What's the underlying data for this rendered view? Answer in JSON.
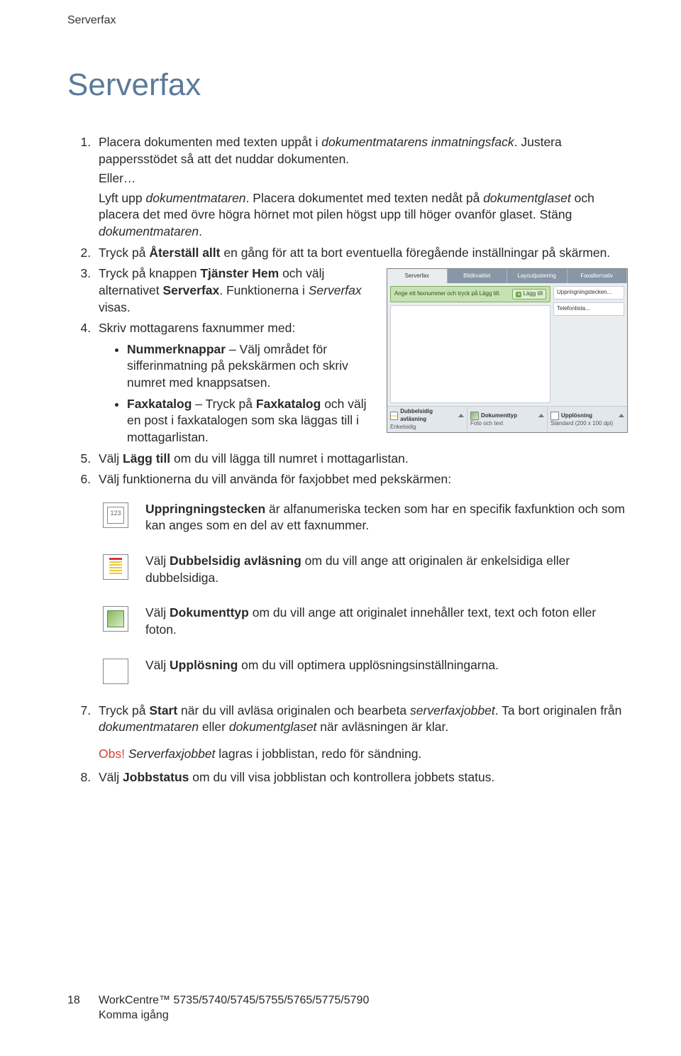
{
  "running_head": "Serverfax",
  "title": "Serverfax",
  "steps": {
    "s1a": "Placera dokumenten med texten uppåt i ",
    "s1a_i": "dokumentmatarens inmatningsfack",
    "s1a_end": ". Justera pappersstödet så att det nuddar dokumenten.",
    "s1_or": "Eller…",
    "s1b": "Lyft upp ",
    "s1b_i": "dokumentmataren",
    "s1b_end": ". Placera dokumentet med texten nedåt på ",
    "s1b_i2": "dokumentglaset",
    "s1b_end2": " och placera det med övre högra hörnet mot pilen högst upp till höger ovanför glaset. Stäng ",
    "s1b_i3": "dokumentmataren",
    "s1b_end3": ".",
    "s2a": "Tryck på ",
    "s2b": "Återställ allt",
    "s2c": " en gång för att ta bort eventuella föregående inställningar på skärmen.",
    "s3a": "Tryck på knappen ",
    "s3b": "Tjänster Hem",
    "s3c": " och välj alternativet ",
    "s3d": "Serverfax",
    "s3e": ". Funktionerna i ",
    "s3f": "Serverfax",
    "s3g": " visas.",
    "s4": "Skriv mottagarens faxnummer med:",
    "s4_b1a": "Nummerknappar",
    "s4_b1b": " – Välj området för sifferinmatning på pekskärmen och skriv numret med knappsatsen.",
    "s4_b2a": "Faxkatalog",
    "s4_b2b": " – Tryck på ",
    "s4_b2c": "Faxkatalog",
    "s4_b2d": " och välj en post i faxkatalogen som ska läggas till i mottagarlistan.",
    "s5a": "Välj ",
    "s5b": "Lägg till",
    "s5c": " om du vill lägga till numret i mottagarlistan.",
    "s6": "Välj funktionerna du vill använda för faxjobbet med pekskärmen:",
    "f_dial_a": "Uppringningstecken",
    "f_dial_b": " är alfanumeriska tecken som har en specifik faxfunktion och som kan anges som en del av ett faxnummer.",
    "f_dup_a": "Välj ",
    "f_dup_b": "Dubbelsidig avläsning",
    "f_dup_c": " om du vill ange att originalen är enkelsidiga eller dubbelsidiga.",
    "f_doc_a": "Välj ",
    "f_doc_b": "Dokumenttyp",
    "f_doc_c": " om du vill ange att originalet innehåller text, text och foton eller foton.",
    "f_res_a": "Välj ",
    "f_res_b": "Upplösning",
    "f_res_c": " om du vill optimera upplösningsinställningarna.",
    "s7a": "Tryck på ",
    "s7b": "Start",
    "s7c": " när du vill avläsa originalen och bearbeta ",
    "s7d": "serverfaxjobbet",
    "s7e": ". Ta bort originalen från ",
    "s7f": "dokumentmataren",
    "s7g": " eller ",
    "s7h": "dokumentglaset",
    "s7i": " när avläsningen är klar.",
    "note_label": "Obs!",
    "note_body_i": "Serverfaxjobbet",
    "note_body": " lagras i jobblistan, redo för sändning.",
    "s8a": "Välj ",
    "s8b": "Jobbstatus",
    "s8c": " om du vill visa jobblistan och kontrollera jobbets status."
  },
  "shot": {
    "tabs": [
      "Serverfax",
      "Bildkvalitet",
      "Layoutjustering",
      "Faxalternativ"
    ],
    "hint": "Ange ett faxnummer och tryck på Lägg till.",
    "add": "Lägg till",
    "side1": "Uppringningstecken...",
    "side2": "Telefonlista...",
    "b1t": "Dubbelsidig avläsning",
    "b1v": "Enkelsidig",
    "b2t": "Dokumenttyp",
    "b2v": "Foto och text",
    "b3t": "Upplösning",
    "b3v": "Standard (200 x 100 dpi)"
  },
  "footer": {
    "page": "18",
    "product": "WorkCentre™ 5735/5740/5745/5755/5765/5775/5790",
    "sub": "Komma igång"
  }
}
